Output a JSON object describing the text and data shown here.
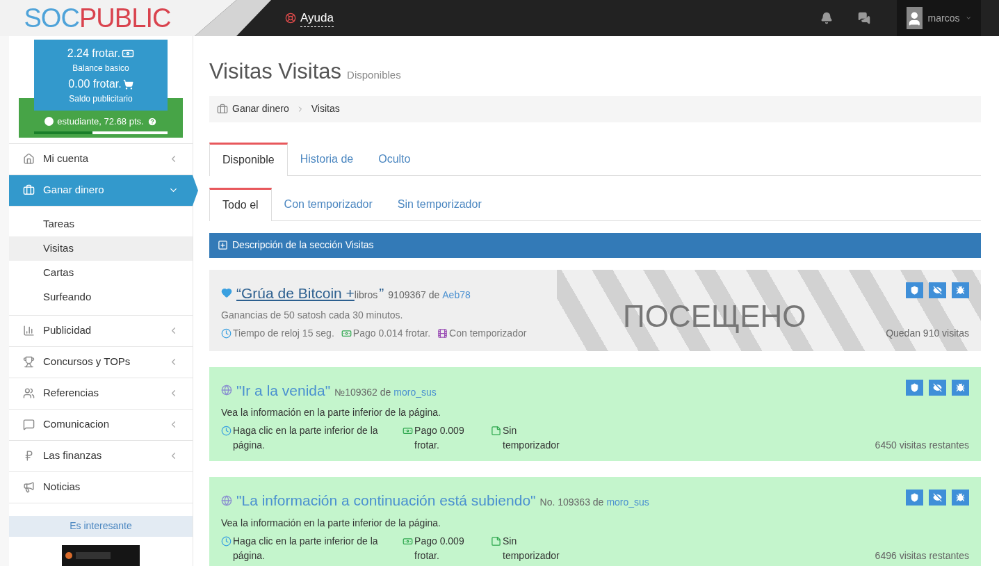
{
  "logo": {
    "part1": "SOC",
    "part2": "PUBLIC"
  },
  "topbar": {
    "help": "Ayuda",
    "user": "marcos"
  },
  "balance": {
    "main_amount": "2.24 frotar.",
    "main_label": "Balance basico",
    "ad_amount": "0.00 frotar.",
    "ad_label": "Saldo publicitario",
    "rank": "estudiante, 72.68 pts.",
    "level": 0.44
  },
  "sidebar": {
    "items": [
      {
        "label": "Mi cuenta",
        "selected": false,
        "expanded": false
      },
      {
        "label": "Ganar dinero",
        "selected": true,
        "expanded": true,
        "children": [
          {
            "label": "Tareas",
            "selected": false
          },
          {
            "label": "Visitas",
            "selected": true
          },
          {
            "label": "Cartas",
            "selected": false
          },
          {
            "label": "Surfeando",
            "selected": false
          }
        ]
      },
      {
        "label": "Publicidad",
        "selected": false,
        "expanded": false
      },
      {
        "label": "Concursos y TOPs",
        "selected": false,
        "expanded": false
      },
      {
        "label": "Referencias",
        "selected": false,
        "expanded": false
      },
      {
        "label": "Comunicacion",
        "selected": false,
        "expanded": false
      },
      {
        "label": "Las finanzas",
        "selected": false,
        "expanded": false
      },
      {
        "label": "Noticias",
        "selected": false
      }
    ],
    "interesting": "Es interesante"
  },
  "page": {
    "title": "Visitas Visitas",
    "subtitle": "Disponibles"
  },
  "breadcrumb": [
    "Ganar dinero",
    "Visitas"
  ],
  "tabs": [
    {
      "label": "Disponible",
      "selected": true
    },
    {
      "label": "Historia de",
      "selected": false
    },
    {
      "label": "Oculto",
      "selected": false
    }
  ],
  "subtabs": [
    {
      "label": "Todo el",
      "selected": true
    },
    {
      "label": "Con temporizador",
      "selected": false
    },
    {
      "label": "Sin temporizador",
      "selected": false
    }
  ],
  "description_bar": "Descripción de la sección Visitas",
  "visits": [
    {
      "kind": "visited",
      "title": "“Grúa de Bitcoin + ",
      "title_small": "libros",
      "title_end": " ”",
      "number": "9109367 de",
      "author": "Aeb78",
      "description": "Ganancias de 50 satosh cada 30 minutos.",
      "stamp": "ПОСЕЩЕНО",
      "meta": [
        {
          "kind": "clock",
          "text": "Tiempo de reloj 15 seg."
        },
        {
          "kind": "money",
          "text": "Pago 0.014 frotar."
        },
        {
          "kind": "film",
          "text": "Con temporizador"
        }
      ],
      "remaining": "Quedan 910 visitas"
    },
    {
      "kind": "available",
      "title": "\"Ir a la venida\"",
      "number": "№109362 de",
      "author": "moro_sus",
      "description": "Vea la información en la parte inferior de la página.",
      "meta": [
        {
          "kind": "clock",
          "text": "Haga clic en la parte inferior de la página."
        },
        {
          "kind": "money",
          "text": "Pago 0.009 frotar."
        },
        {
          "kind": "note",
          "text": "Sin temporizador"
        }
      ],
      "remaining": "6450 visitas restantes"
    },
    {
      "kind": "available",
      "title": "\"La información a continuación está subiendo\"",
      "number": "No. 109363 de",
      "author": "moro_sus",
      "description": "Vea la información en la parte inferior de la página.",
      "meta": [
        {
          "kind": "clock",
          "text": "Haga clic en la parte inferior de la página."
        },
        {
          "kind": "money",
          "text": "Pago 0.009 frotar."
        },
        {
          "kind": "note",
          "text": "Sin temporizador"
        }
      ],
      "remaining": "6496 visitas restantes"
    }
  ]
}
